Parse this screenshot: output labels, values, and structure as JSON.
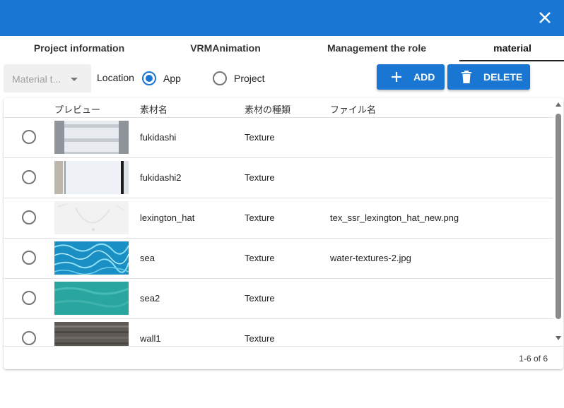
{
  "header": {
    "close_icon": "close-icon",
    "color": "#1976d2"
  },
  "tabs": [
    {
      "label": "Project information"
    },
    {
      "label": "VRMAnimation"
    },
    {
      "label": "Management the role"
    },
    {
      "label": "material"
    }
  ],
  "active_tab": "material",
  "toolbar": {
    "material_type_placeholder": "Material t...",
    "location_label": "Location",
    "location_options": [
      {
        "label": "App",
        "selected": true
      },
      {
        "label": "Project",
        "selected": false
      }
    ],
    "add_label": "ADD",
    "add_icon": "plus-icon",
    "delete_label": "DELETE",
    "delete_icon": "trash-icon"
  },
  "table": {
    "columns": [
      "プレビュー",
      "素材名",
      "素材の種類",
      "ファイル名"
    ],
    "rows": [
      {
        "preview": "wall-white-tiles",
        "name": "fukidashi",
        "type": "Texture",
        "file": ""
      },
      {
        "preview": "white-panel",
        "name": "fukidashi2",
        "type": "Texture",
        "file": ""
      },
      {
        "preview": "white-fabric",
        "name": "lexington_hat",
        "type": "Texture",
        "file": "tex_ssr_lexington_hat_new.png"
      },
      {
        "preview": "water-caustics",
        "name": "sea",
        "type": "Texture",
        "file": "water-textures-2.jpg"
      },
      {
        "preview": "teal-water",
        "name": "sea2",
        "type": "Texture",
        "file": ""
      },
      {
        "preview": "wood-planks",
        "name": "wall1",
        "type": "Texture",
        "file": ""
      }
    ],
    "pagination": "1-6 of 6"
  }
}
